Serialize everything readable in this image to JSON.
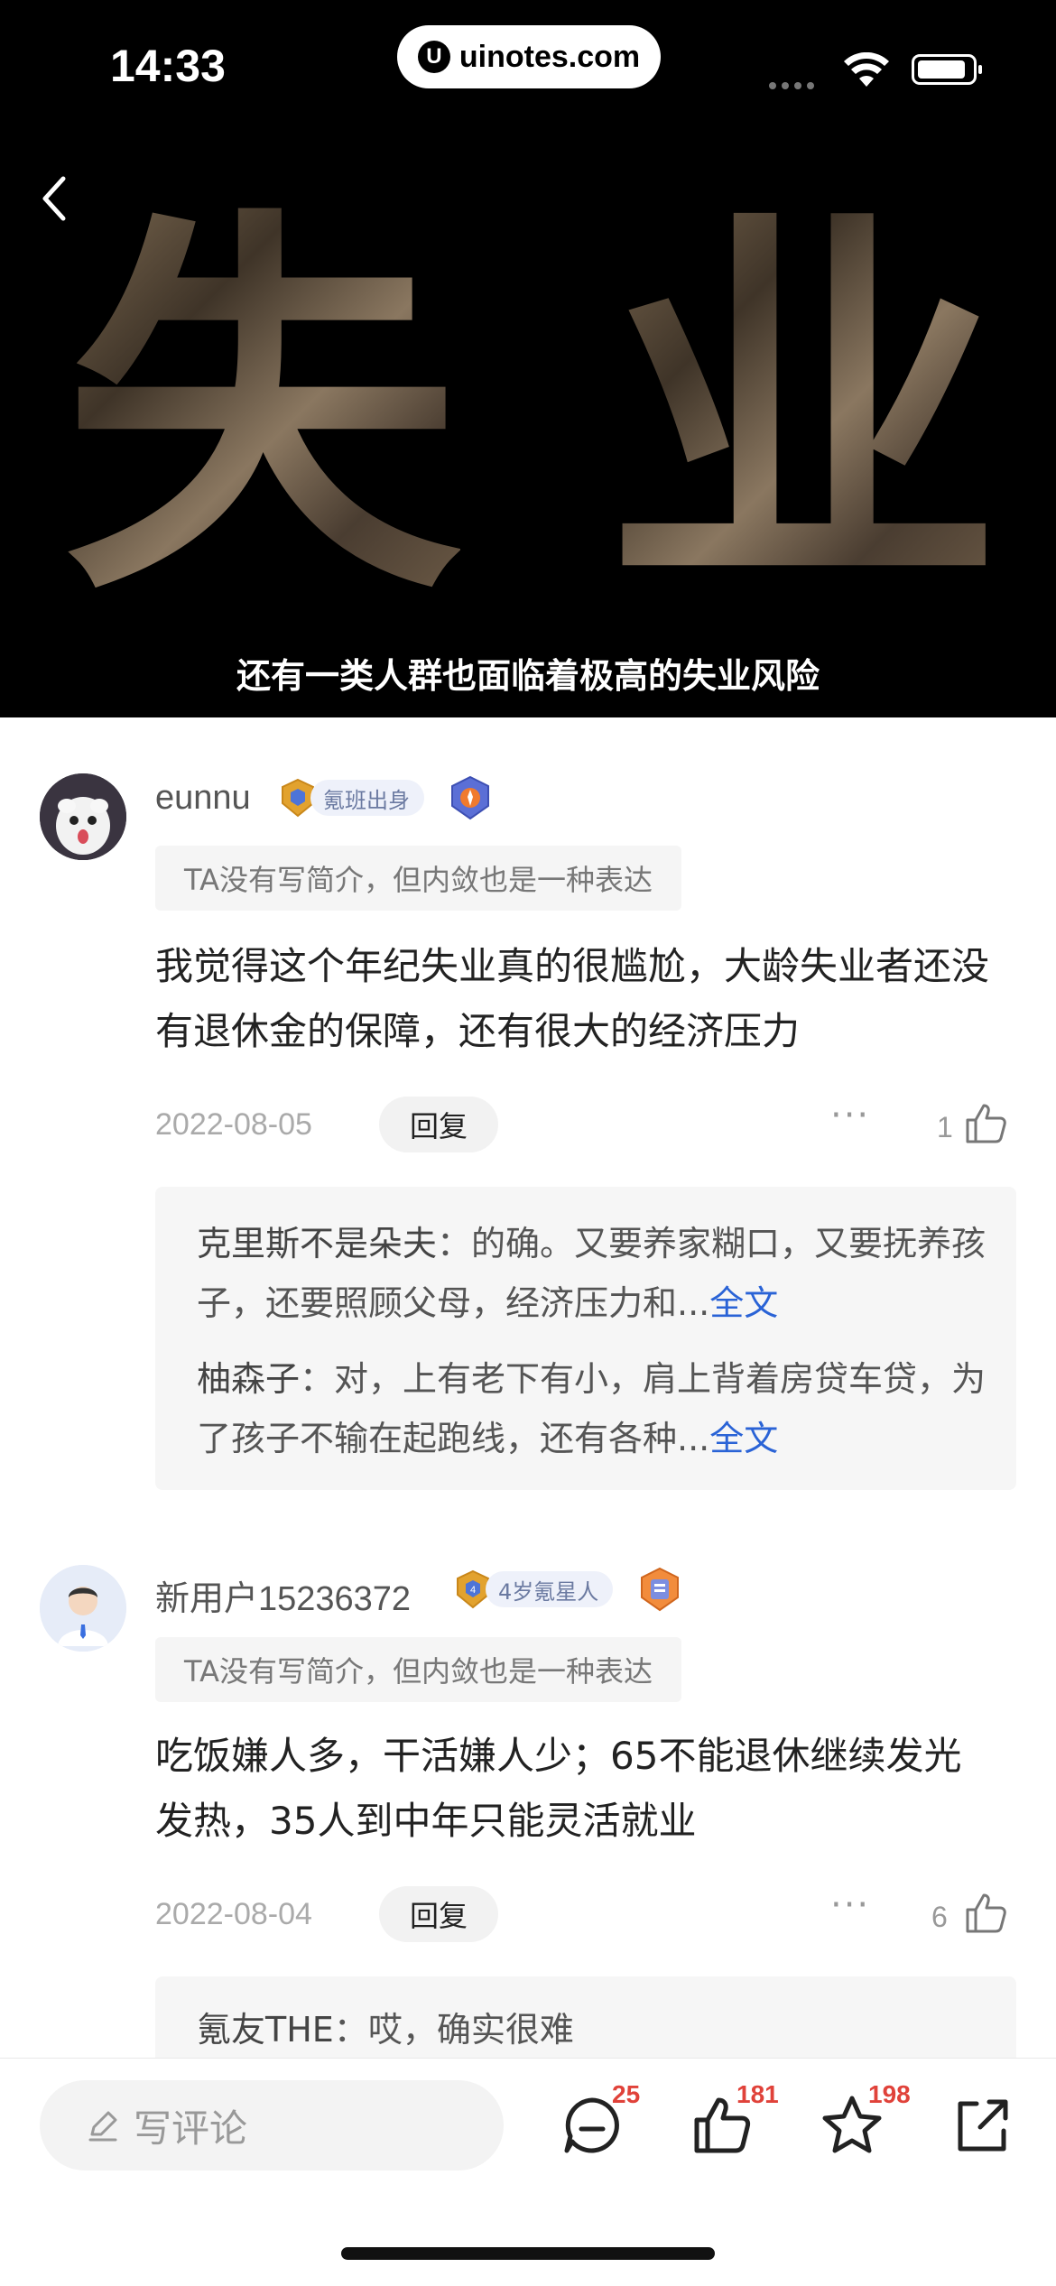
{
  "status_bar": {
    "time": "14:33",
    "url": "uinotes.com",
    "url_logo": "U"
  },
  "video": {
    "headline_chars": [
      "失",
      "业"
    ],
    "subtitle": "还有一类人群也面临着极高的失业风险"
  },
  "comments": [
    {
      "username": "eunnu",
      "badge_label": "氪班出身",
      "bio": "TA没有写简介，但内敛也是一种表达",
      "text": "我觉得这个年纪失业真的很尴尬，大龄失业者还没有退休金的保障，还有很大的经济压力",
      "date": "2022-08-05",
      "reply_label": "回复",
      "more": "···",
      "likes": "1",
      "replies": [
        {
          "author": "克里斯不是朵夫",
          "sep": "：",
          "text": "的确。又要养家糊口，又要抚养孩子，还要照顾父母，经济压力和...",
          "full": "全文"
        },
        {
          "author": "柚森子",
          "sep": "：",
          "text": "对，上有老下有小，肩上背着房贷车贷，为了孩子不输在起跑线，还有各种...",
          "full": "全文"
        }
      ]
    },
    {
      "username": "新用户15236372",
      "badge_label": "4岁氪星人",
      "badge_number": "4",
      "bio": "TA没有写简介，但内敛也是一种表达",
      "text": "吃饭嫌人多，干活嫌人少；65不能退休继续发光发热，35人到中年只能灵活就业",
      "date": "2022-08-04",
      "reply_label": "回复",
      "more": "···",
      "likes": "6",
      "replies": [
        {
          "author": "氪友THE",
          "sep": "：",
          "text": "哎，确实很难"
        }
      ]
    }
  ],
  "bottom_bar": {
    "placeholder": "写评论",
    "comment_count": "25",
    "like_count": "181",
    "favorite_count": "198"
  },
  "colors": {
    "link": "#2a63d6",
    "count_red": "#e0423a",
    "badge_bg": "#eef1fa"
  }
}
